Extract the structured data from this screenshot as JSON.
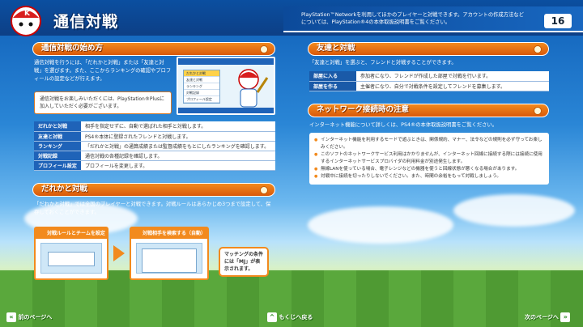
{
  "header": {
    "title": "通信対戦",
    "note": "PlayStation™Networkを利用してほかのプレイヤーと対戦できます。アカウントの作成方法などについては、PlayStation®4の本体取扱説明書をご覧ください。",
    "page_number": "16"
  },
  "left": {
    "section1_title": "通信対戦の始め方",
    "section1_text": "通信対戦を行うには、「だれかと対戦」または「友達と対戦」を選びます。また、ここからランキングの確認やプロフィールの設定などが行えます。",
    "notice": "通信対戦をお楽しみいただくには、PlayStation®Plusに加入していただく必要がございます。",
    "menu": [
      {
        "key": "だれかと対戦",
        "value": "相手を指定せずに、自動で選ばれた相手と対戦します。"
      },
      {
        "key": "友達と対戦",
        "value": "PS4®本体に登録されたフレンドと対戦します。"
      },
      {
        "key": "ランキング",
        "value": "「だれかと対戦」の通算成績または監督成績をもとにしたランキングを確認します。"
      },
      {
        "key": "対戦記録",
        "value": "通信対戦の各種記録を確認します。"
      },
      {
        "key": "プロフィール設定",
        "value": "プロフィールを変更します。"
      }
    ],
    "shot_menu": [
      "だれかと対戦",
      "友達と対戦",
      "ランキング",
      "対戦記録",
      "プロフィール設定"
    ],
    "section2_title": "だれかと対戦",
    "section2_text": "「だれかと対戦」では全国のプレイヤーと対戦できます。対戦ルールはあらかじめ3つまで設定して、保存しておくことができます。",
    "step1_label": "対戦ルールとチームを設定",
    "step2_label": "対戦相手を検索する（自動）",
    "bubble": "マッチングの条件には「MJ」が表示されます。"
  },
  "right": {
    "section3_title": "友達と対戦",
    "section3_text": "「友達と対戦」を選ぶと、フレンドと対戦することができます。",
    "rooms": [
      {
        "key": "部屋に入る",
        "value": "参加者になり、フレンドが作成した部屋で対戦を行います。"
      },
      {
        "key": "部屋を作る",
        "value": "主催者になり、自分で対戦条件を設定してフレンドを募集します。"
      }
    ],
    "section4_title": "ネットワーク接続時の注意",
    "section4_text": "インターネット機能について詳しくは、PS4®の本体取扱説明書をご覧ください。",
    "bullets": [
      "インターネット機能を利用するモードで遊ぶときは、関係規約、マナー、法令などの規則を必ず守ってお楽しみください。",
      "このソフトのネットワークサービス利用はかかりませんが、インターネット回線に接続する際には接続に使用するインターネットサービスプロバイダの利用料金が別途発生します。",
      "無線LANを使っている場合、電子レンジなどの機器を使うと回線状態が悪くなる場合があります。",
      "対戦中に接続を切ったりしないでください。また、時間の余裕をもって対戦しましょう。"
    ]
  },
  "nav": {
    "prev": "前のページへ",
    "toc": "もくじへ戻る",
    "next": "次のページへ"
  },
  "colors": {
    "accent": "#f28a1d",
    "header": "#0d3f86",
    "menu_key": "#1f63b8"
  }
}
